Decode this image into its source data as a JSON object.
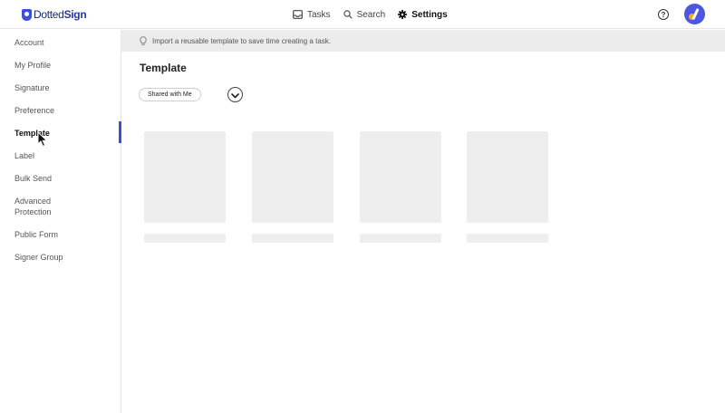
{
  "app": {
    "logo": {
      "part1": "Dotted",
      "part2": "Sign"
    }
  },
  "header": {
    "nav": [
      {
        "label": "Tasks",
        "icon": "tray-icon"
      },
      {
        "label": "Search",
        "icon": "search-icon"
      },
      {
        "label": "Settings",
        "icon": "gear-icon",
        "active": true
      }
    ],
    "help_glyph": "?",
    "accent_color": "#3c4fd8"
  },
  "sidebar": {
    "items": [
      {
        "label": "Account"
      },
      {
        "label": "My Profile"
      },
      {
        "label": "Signature"
      },
      {
        "label": "Preference"
      },
      {
        "label": "Template",
        "active": true
      },
      {
        "label": "Label"
      },
      {
        "label": "Bulk Send"
      },
      {
        "label": "Advanced Protection"
      },
      {
        "label": "Public Form"
      },
      {
        "label": "Signer Group"
      }
    ]
  },
  "main": {
    "banner_text": "Import a reusable template to save time creating a task.",
    "title": "Template",
    "filter_label": "Shared with Me"
  }
}
